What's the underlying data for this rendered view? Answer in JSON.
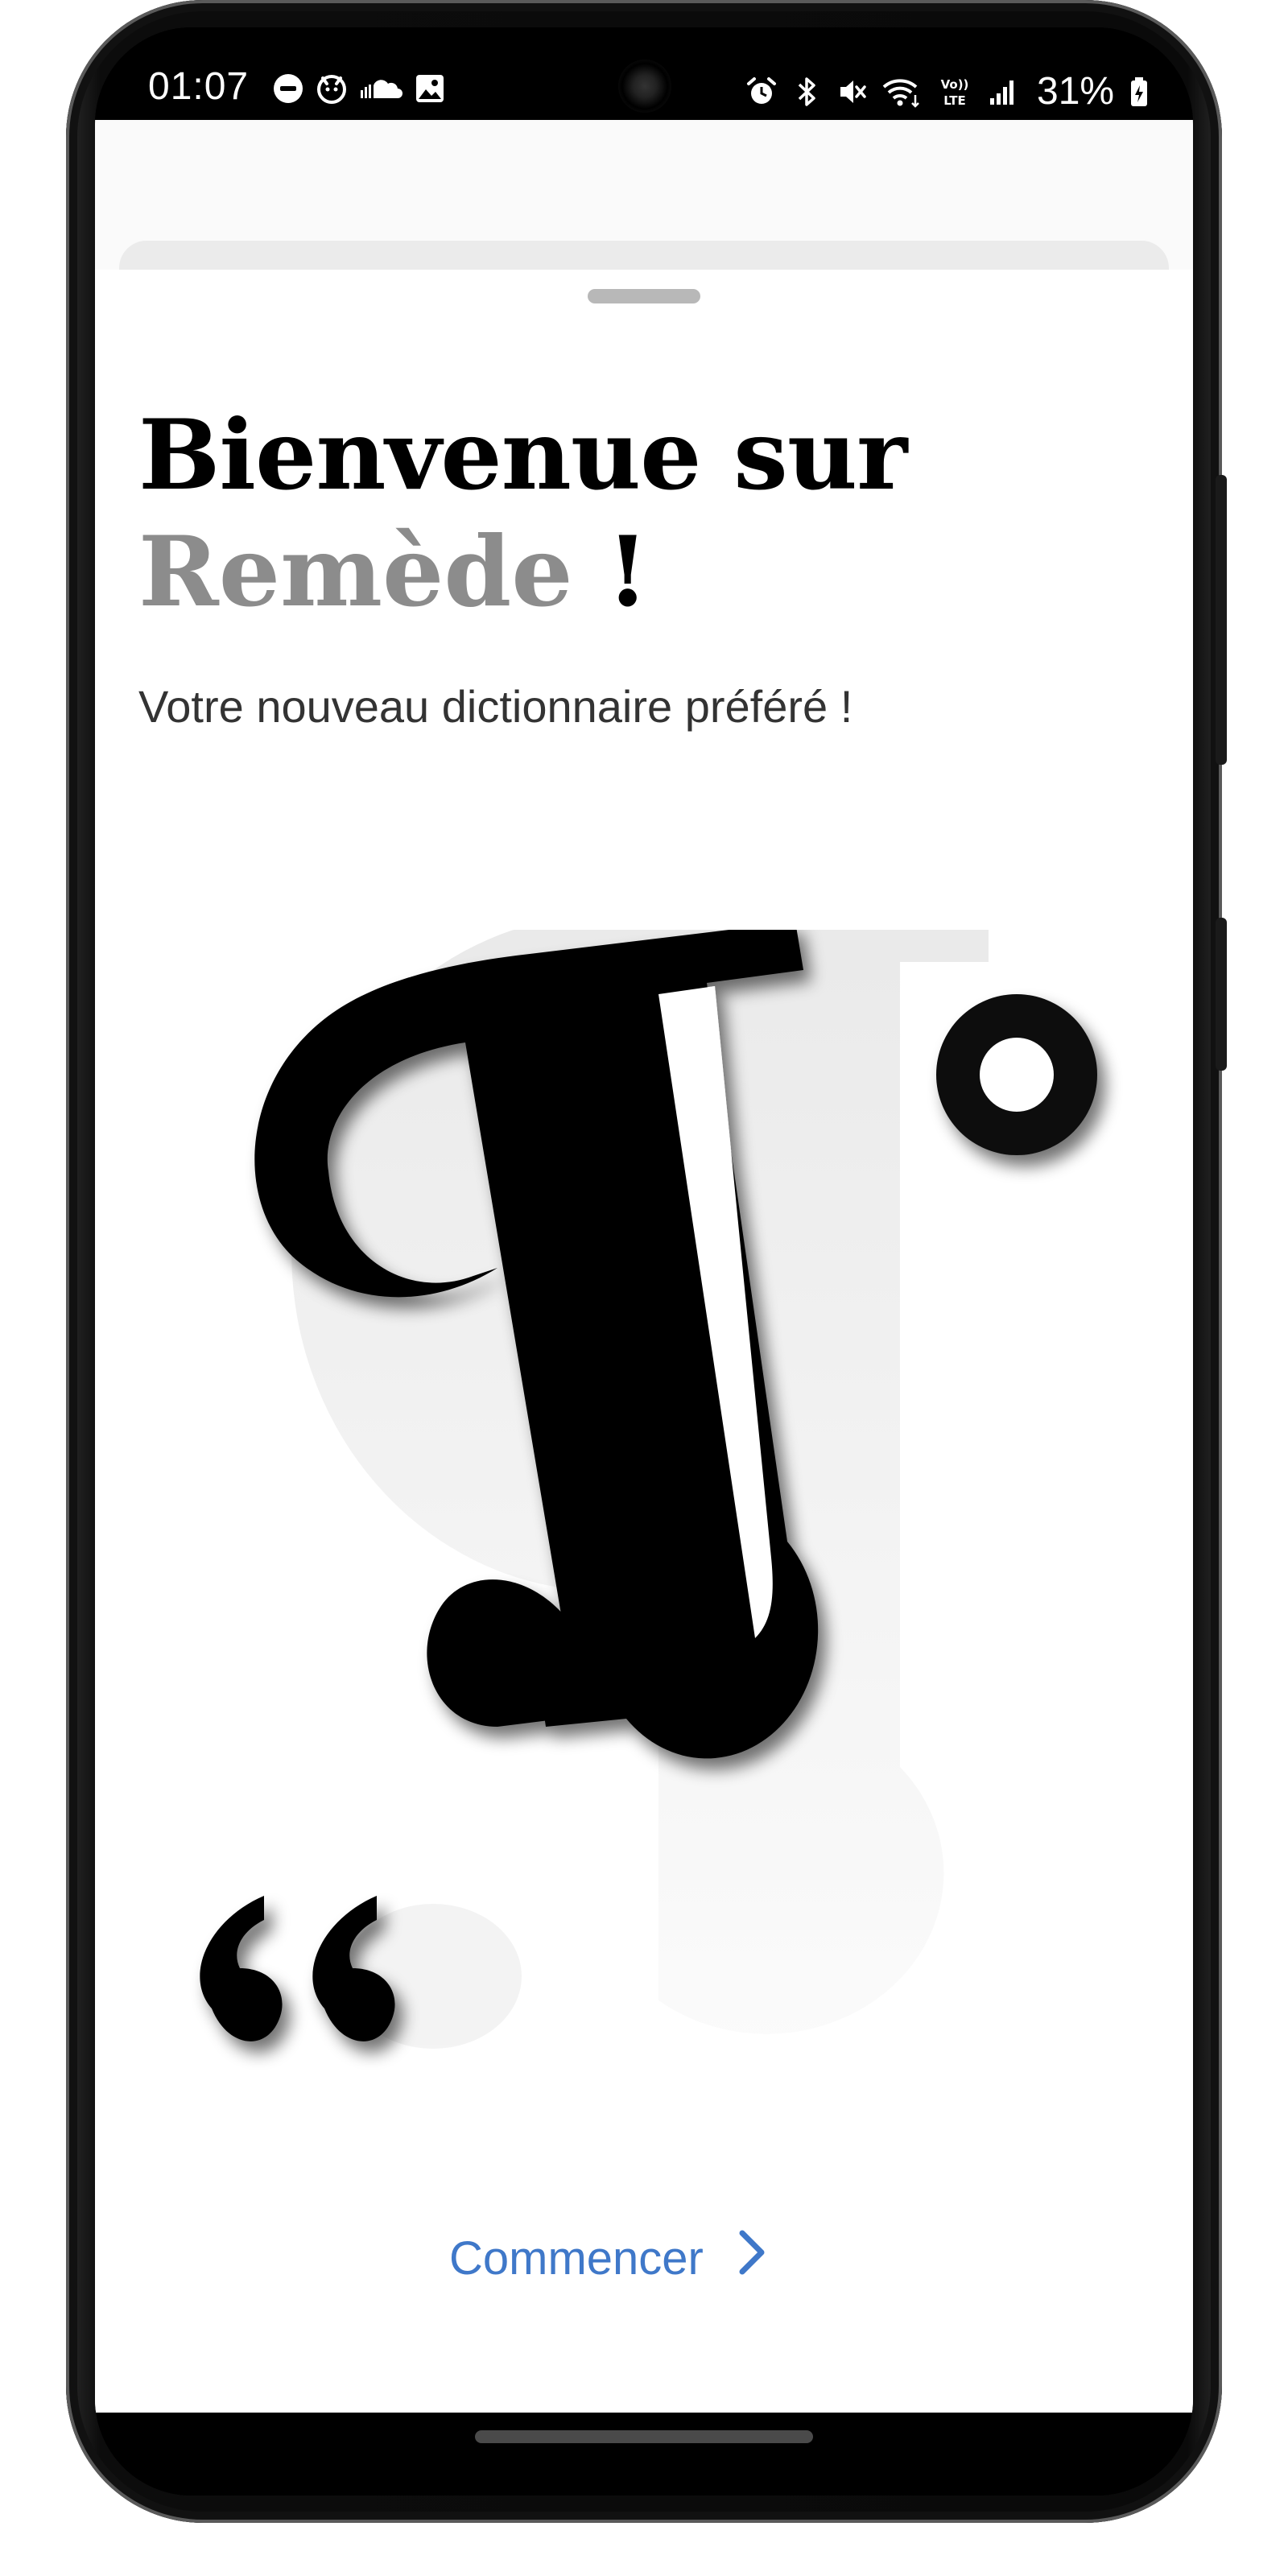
{
  "status_bar": {
    "time": "01:07",
    "left_icons": [
      "do-not-disturb-icon",
      "messenger-icon",
      "cloud-icon",
      "gallery-icon"
    ],
    "right_icons": [
      "alarm-icon",
      "bluetooth-icon",
      "mute-icon",
      "wifi-icon",
      "volte-icon",
      "signal-icon"
    ],
    "volte_label": "Vo)) LTE",
    "battery_percent": "31%"
  },
  "welcome": {
    "title_line1": "Bienvenue sur",
    "app_name": "Remède",
    "title_suffix": " !",
    "subtitle": "Votre nouveau dictionnaire préféré !"
  },
  "illustration": {
    "pilcrow_icon": "pilcrow-icon",
    "degree_icon": "degree-icon",
    "quote_icon": "opening-quote-icon"
  },
  "cta": {
    "label": "Commencer",
    "icon": "chevron-right-icon",
    "color": "#3f78c9"
  },
  "colors": {
    "title": "#000000",
    "app_name": "#8c8c8c",
    "subtitle": "#333333",
    "background": "#ffffff"
  }
}
